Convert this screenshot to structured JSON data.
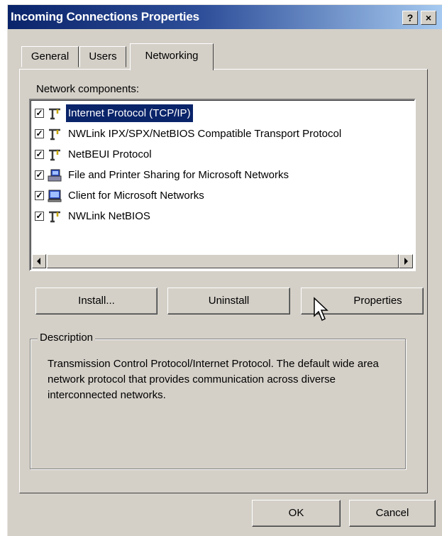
{
  "window": {
    "title": "Incoming Connections Properties",
    "help_label": "?",
    "close_label": "×"
  },
  "tabs": [
    {
      "label": "General",
      "active": false
    },
    {
      "label": "Users",
      "active": false
    },
    {
      "label": "Networking",
      "active": true
    }
  ],
  "networking": {
    "components_label": "Network components:",
    "components": [
      {
        "label": "Internet Protocol (TCP/IP)",
        "checked": true,
        "selected": true,
        "icon": "network-protocol-icon"
      },
      {
        "label": "NWLink IPX/SPX/NetBIOS Compatible Transport Protocol",
        "checked": true,
        "selected": false,
        "icon": "network-protocol-icon"
      },
      {
        "label": "NetBEUI Protocol",
        "checked": true,
        "selected": false,
        "icon": "network-protocol-icon"
      },
      {
        "label": "File and Printer Sharing for Microsoft Networks",
        "checked": true,
        "selected": false,
        "icon": "network-service-icon"
      },
      {
        "label": "Client for Microsoft Networks",
        "checked": true,
        "selected": false,
        "icon": "network-client-icon"
      },
      {
        "label": "NWLink NetBIOS",
        "checked": true,
        "selected": false,
        "icon": "network-protocol-icon"
      }
    ],
    "buttons": {
      "install": "Install...",
      "uninstall": "Uninstall",
      "properties": "Properties"
    },
    "description": {
      "title": "Description",
      "text": "Transmission Control Protocol/Internet Protocol. The default wide area network protocol that provides communication across diverse interconnected networks."
    }
  },
  "footer": {
    "ok": "OK",
    "cancel": "Cancel"
  },
  "colors": {
    "face": "#d4d0c8",
    "title_start": "#0a246a",
    "title_end": "#a6caf0",
    "selection": "#0a246a"
  }
}
